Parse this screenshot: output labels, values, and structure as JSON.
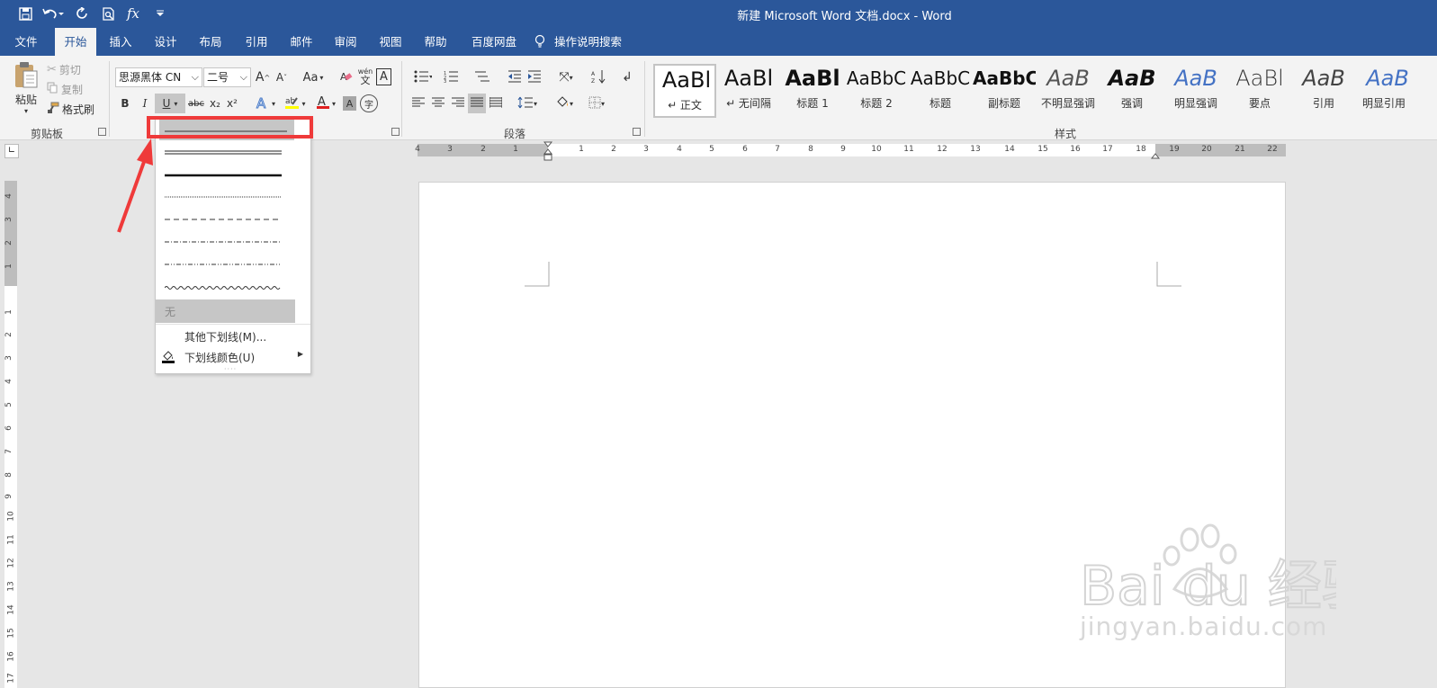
{
  "window": {
    "title": "新建 Microsoft Word 文档.docx  -  Word",
    "accent_color": "#2b579a"
  },
  "quick_access": {
    "icons": [
      "save-icon",
      "undo-icon",
      "redo-icon",
      "print-preview-icon",
      "function-icon",
      "customize-icon"
    ],
    "fx_label": "fx"
  },
  "tabs": [
    {
      "label": "文件"
    },
    {
      "label": "开始",
      "active": true
    },
    {
      "label": "插入"
    },
    {
      "label": "设计"
    },
    {
      "label": "布局"
    },
    {
      "label": "引用"
    },
    {
      "label": "邮件"
    },
    {
      "label": "审阅"
    },
    {
      "label": "视图"
    },
    {
      "label": "帮助"
    },
    {
      "label": "百度网盘"
    }
  ],
  "tell_me": "操作说明搜索",
  "clipboard": {
    "paste": "粘贴",
    "cut": "剪切",
    "copy": "复制",
    "format_painter": "格式刷",
    "group_label": "剪贴板"
  },
  "font": {
    "font_name": "思源黑体 CN",
    "font_size": "二号",
    "grow": "A",
    "shrink": "A",
    "case": "Aa",
    "bold": "B",
    "italic": "I",
    "underline": "U",
    "strikethrough": "abc",
    "subscript": "x₂",
    "superscript": "x²",
    "phonetic": "wén",
    "border_char": "A",
    "enclose_char": "字"
  },
  "paragraph": {
    "group_label": "段落"
  },
  "styles": {
    "group_label": "样式",
    "items": [
      {
        "sample": "AaBl",
        "name": "↵ 正文",
        "selected": true
      },
      {
        "sample": "AaBl",
        "name": "↵ 无间隔"
      },
      {
        "sample": "AaBl",
        "name": "标题 1"
      },
      {
        "sample": "AaBbC",
        "name": "标题 2"
      },
      {
        "sample": "AaBbC",
        "name": "标题"
      },
      {
        "sample": "AaBbC",
        "name": "副标题"
      },
      {
        "sample": "AaB",
        "name": "不明显强调"
      },
      {
        "sample": "AaB",
        "name": "强调"
      },
      {
        "sample": "AaB",
        "name": "明显强调"
      },
      {
        "sample": "AaBl",
        "name": "要点"
      },
      {
        "sample": "AaB",
        "name": "引用"
      },
      {
        "sample": "AaB",
        "name": "明显引用"
      }
    ]
  },
  "underline_menu": {
    "options": [
      "single",
      "double",
      "thick",
      "dotted",
      "dashed",
      "dash-dot",
      "dash-dot-dot",
      "wave"
    ],
    "none_label": "无",
    "more_label": "其他下划线(M)...",
    "color_label": "下划线颜色(U)"
  },
  "hruler": {
    "left_numbers": [
      "4",
      "3",
      "2",
      "1"
    ],
    "right_numbers": [
      "1",
      "2",
      "3",
      "4",
      "5",
      "6",
      "7",
      "8",
      "9",
      "10",
      "11",
      "12",
      "13",
      "14",
      "15",
      "16",
      "17",
      "18",
      "19",
      "20",
      "21",
      "22"
    ]
  },
  "vruler": {
    "top_numbers": [
      "4",
      "3",
      "2",
      "1"
    ],
    "numbers": [
      "1",
      "2",
      "3",
      "4",
      "5",
      "6",
      "7",
      "8",
      "9",
      "10",
      "11",
      "12",
      "13",
      "14",
      "15",
      "16",
      "17"
    ]
  },
  "watermark": {
    "brand": "Bai du 经验",
    "url": "jingyan.baidu.com"
  }
}
